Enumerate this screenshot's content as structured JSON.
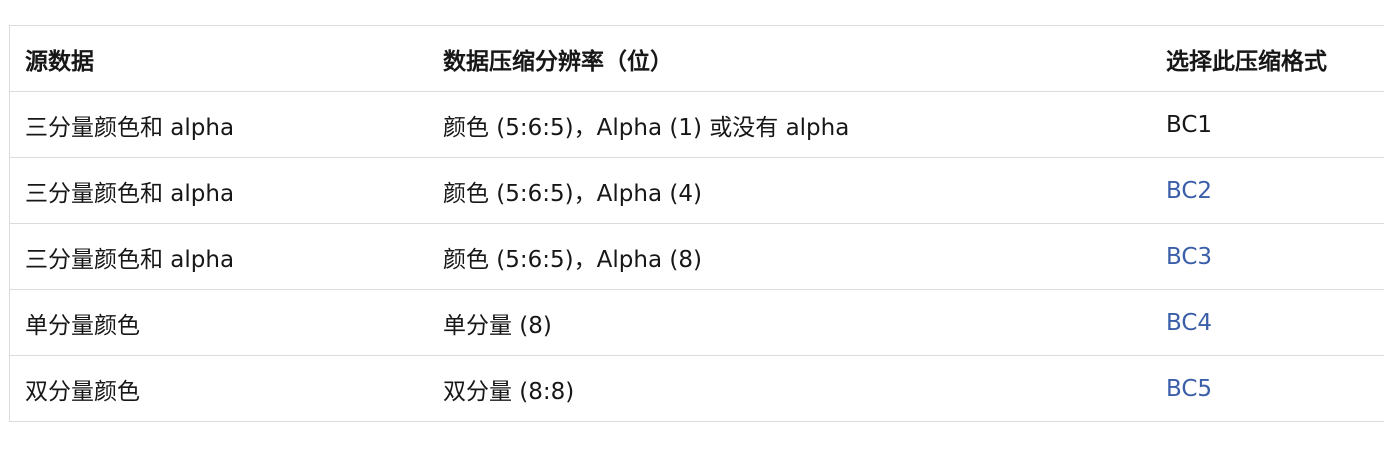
{
  "table": {
    "headers": [
      "源数据",
      "数据压缩分辨率（位）",
      "选择此压缩格式"
    ],
    "rows": [
      {
        "source": "三分量颜色和 alpha",
        "resolution": "颜色 (5:6:5)，Alpha (1) 或没有 alpha",
        "format": "BC1",
        "format_is_link": false
      },
      {
        "source": "三分量颜色和 alpha",
        "resolution": "颜色 (5:6:5)，Alpha (4)",
        "format": "BC2",
        "format_is_link": true
      },
      {
        "source": "三分量颜色和 alpha",
        "resolution": "颜色 (5:6:5)，Alpha (8)",
        "format": "BC3",
        "format_is_link": true
      },
      {
        "source": "单分量颜色",
        "resolution": "单分量 (8)",
        "format": "BC4",
        "format_is_link": true
      },
      {
        "source": "双分量颜色",
        "resolution": "双分量 (8:8)",
        "format": "BC5",
        "format_is_link": true
      }
    ]
  },
  "colors": {
    "link": "#3a5ea8",
    "text": "#171717",
    "border": "#dcdcdc"
  }
}
